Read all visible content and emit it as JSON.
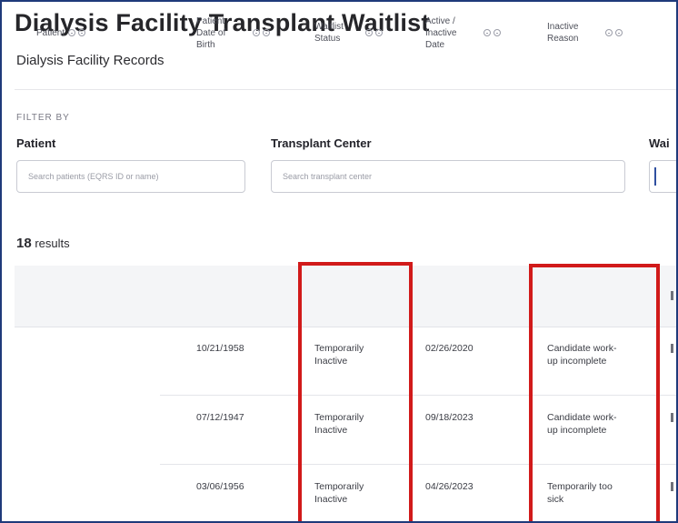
{
  "page": {
    "title": "Dialysis Facility Transplant Waitlist",
    "subtitle": "Dialysis Facility Records"
  },
  "filters": {
    "section_label": "FILTER BY",
    "patient": {
      "label": "Patient",
      "placeholder": "Search patients (EQRS ID or name)"
    },
    "transplant_center": {
      "label": "Transplant Center",
      "placeholder": "Search transplant center"
    },
    "third": {
      "label": "Wai",
      "placeholder": ""
    }
  },
  "results": {
    "count": "18",
    "label": "results"
  },
  "table": {
    "columns": [
      {
        "label": "Patient"
      },
      {
        "label": "Patient\nDate of\nBirth"
      },
      {
        "label": "Waitlist\nStatus"
      },
      {
        "label": "Active /\nInactive\nDate"
      },
      {
        "label": "Inactive\nReason"
      }
    ],
    "rows": [
      {
        "dob": "10/21/1958",
        "status": "Temporarily\nInactive",
        "date": "02/26/2020",
        "reason": "Candidate work-\nup incomplete"
      },
      {
        "dob": "07/12/1947",
        "status": "Temporarily\nInactive",
        "date": "09/18/2023",
        "reason": "Candidate work-\nup incomplete"
      },
      {
        "dob": "03/06/1956",
        "status": "Temporarily\nInactive",
        "date": "04/26/2023",
        "reason": "Temporarily too\nsick"
      }
    ]
  },
  "colors": {
    "frame_border": "#1f3a7a",
    "highlight_box": "#d11a1a",
    "header_bg": "#f4f5f7"
  }
}
